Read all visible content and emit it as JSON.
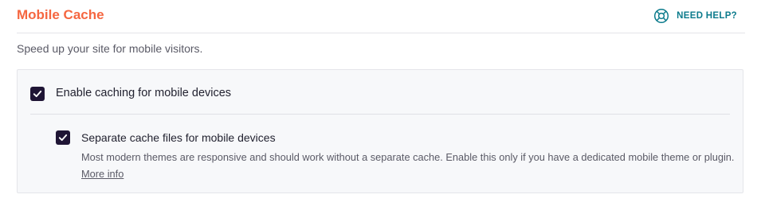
{
  "header": {
    "title": "Mobile Cache",
    "help_label": "NEED HELP?",
    "help_icon": "lifebuoy-icon"
  },
  "description": "Speed up your site for mobile visitors.",
  "settings": {
    "enable_mobile": {
      "label": "Enable caching for mobile devices",
      "checked": true
    },
    "separate_cache": {
      "label": "Separate cache files for mobile devices",
      "checked": true,
      "help_text": "Most modern themes are responsive and should work without a separate cache. Enable this only if you have a dedicated mobile theme or plugin.",
      "more_info_link": "More info"
    }
  },
  "colors": {
    "title": "#f56640",
    "help": "#0c7b8c",
    "checkbox": "#1f1535",
    "panel_bg": "#f7f8fa"
  }
}
